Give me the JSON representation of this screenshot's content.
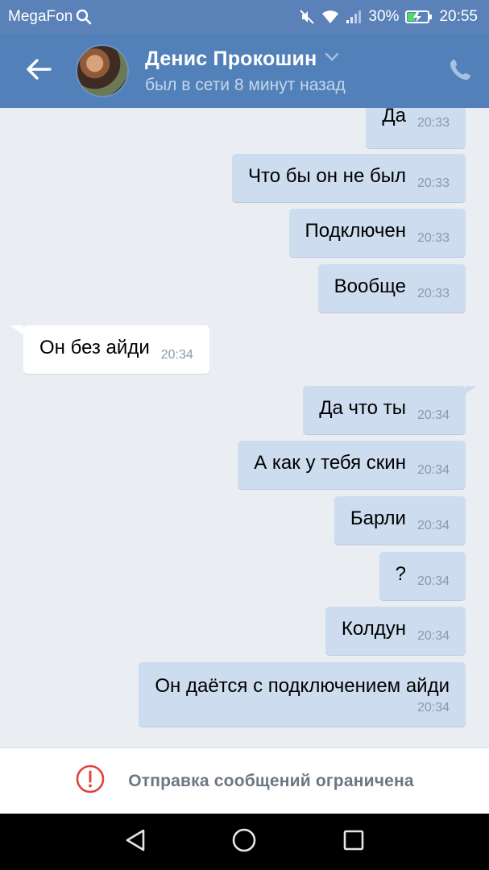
{
  "status_bar": {
    "carrier": "MegaFon",
    "battery": "30%",
    "time": "20:55",
    "icons": [
      "search-icon",
      "mute-icon",
      "wifi-icon",
      "signal-icon",
      "battery-charging-icon"
    ]
  },
  "header": {
    "contact_name": "Денис Прокошин",
    "contact_status": "был в сети 8 минут назад",
    "icons": [
      "back-arrow-icon",
      "chevron-down-icon",
      "phone-icon"
    ]
  },
  "messages": [
    {
      "dir": "out",
      "text": "Да",
      "time": "20:33"
    },
    {
      "dir": "out",
      "text": "Что бы он не был",
      "time": "20:33"
    },
    {
      "dir": "out",
      "text": "Подключен",
      "time": "20:33"
    },
    {
      "dir": "out",
      "text": "Вообще",
      "time": "20:33"
    },
    {
      "dir": "in",
      "text": "Он без айди",
      "time": "20:34"
    },
    {
      "dir": "out",
      "text": "Да что ты",
      "time": "20:34"
    },
    {
      "dir": "out",
      "text": "А как у тебя скин",
      "time": "20:34"
    },
    {
      "dir": "out",
      "text": "Барли",
      "time": "20:34"
    },
    {
      "dir": "out",
      "text": "?",
      "time": "20:34"
    },
    {
      "dir": "out",
      "text": "Колдун",
      "time": "20:34"
    },
    {
      "dir": "out",
      "text": "Он даётся с подключением айди",
      "time": "20:34"
    }
  ],
  "restriction": {
    "text": "Отправка сообщений ограничена",
    "icon": "alert-circle-icon",
    "icon_color": "#e0443a"
  },
  "nav": {
    "icons": [
      "back-triangle-icon",
      "home-circle-icon",
      "recents-square-icon"
    ]
  },
  "colors": {
    "header_bg": "#5181b8",
    "outgoing_bubble": "#cddcee",
    "incoming_bubble": "#ffffff",
    "chat_bg": "#eaeef3"
  }
}
